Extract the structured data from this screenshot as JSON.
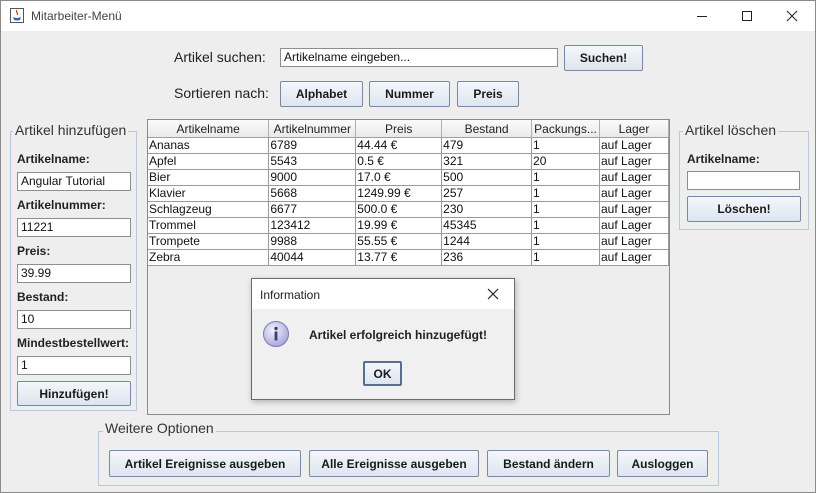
{
  "window": {
    "title": "Mitarbeiter-Menü"
  },
  "search": {
    "label": "Artikel suchen:",
    "value": "Artikelname eingeben...",
    "button": "Suchen!"
  },
  "sort": {
    "label": "Sortieren nach:",
    "buttons": [
      "Alphabet",
      "Nummer",
      "Preis"
    ]
  },
  "add_panel": {
    "title": "Artikel hinzufügen",
    "fields": [
      {
        "label": "Artikelname:",
        "value": "Angular Tutorial"
      },
      {
        "label": "Artikelnummer:",
        "value": "11221"
      },
      {
        "label": "Preis:",
        "value": "39.99"
      },
      {
        "label": "Bestand:",
        "value": "10"
      },
      {
        "label": "Mindestbestellwert:",
        "value": "1"
      }
    ],
    "button": "Hinzufügen!"
  },
  "delete_panel": {
    "title": "Artikel löschen",
    "field_label": "Artikelname:",
    "field_value": "",
    "button": "Löschen!"
  },
  "table": {
    "headers": [
      "Artikelname",
      "Artikelnummer",
      "Preis",
      "Bestand",
      "Packungs...",
      "Lager"
    ],
    "rows": [
      [
        "Ananas",
        "6789",
        "44.44 €",
        "479",
        "1",
        "auf Lager"
      ],
      [
        "Apfel",
        "5543",
        "0.5 €",
        "321",
        "20",
        "auf Lager"
      ],
      [
        "Bier",
        "9000",
        "17.0 €",
        "500",
        "1",
        "auf Lager"
      ],
      [
        "Klavier",
        "5668",
        "1249.99 €",
        "257",
        "1",
        "auf Lager"
      ],
      [
        "Schlagzeug",
        "6677",
        "500.0 €",
        "230",
        "1",
        "auf Lager"
      ],
      [
        "Trommel",
        "123412",
        "19.99 €",
        "45345",
        "1",
        "auf Lager"
      ],
      [
        "Trompete",
        "9988",
        "55.55 €",
        "1244",
        "1",
        "auf Lager"
      ],
      [
        "Zebra",
        "40044",
        "13.77 €",
        "236",
        "1",
        "auf Lager"
      ]
    ]
  },
  "options": {
    "title": "Weitere Optionen",
    "buttons": [
      "Artikel Ereignisse ausgeben",
      "Alle Ereignisse ausgeben",
      "Bestand ändern",
      "Ausloggen"
    ]
  },
  "dialog": {
    "title": "Information",
    "message": "Artikel erfolgreich hinzugefügt!",
    "button": "OK",
    "icon": "info-icon"
  },
  "colors": {
    "button_border": "#7a8a9e",
    "group_border": "#b9c9dc",
    "info_icon": "#7a7ab8"
  }
}
